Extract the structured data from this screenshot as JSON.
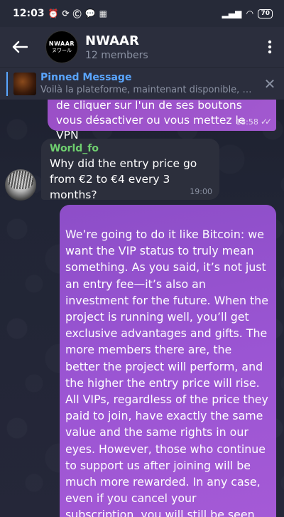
{
  "status_bar": {
    "time": "12:03",
    "icons": [
      "alarm-icon",
      "sync-icon",
      "c-icon",
      "chat-icon",
      "grid-icon"
    ],
    "battery": "70"
  },
  "header": {
    "group_name": "NWAAR",
    "member_count": "12 members",
    "avatar_text_top": "NWAAR",
    "avatar_text_bottom": "ヌワール"
  },
  "pinned": {
    "title": "Pinned Message",
    "preview": "Voilà la plateforme, maintenant disponible, e…"
  },
  "messages": [
    {
      "direction": "outgoing",
      "text": "de cliquer sur l'un de ses boutons vous désactiver ou vous mettez le VPN",
      "time": "18:58",
      "status": "read"
    },
    {
      "direction": "incoming",
      "sender": "World_fo",
      "text": "Why did the entry price go from €2 to €4 every 3 months?",
      "time": "19:00"
    },
    {
      "direction": "outgoing",
      "text": "We’re going to do it like Bitcoin: we want the VIP status to truly mean something. As you said, it’s not just an entry fee—it’s also an investment for the future. When the project is running well, you’ll get exclusive advantages and gifts. The more members there are, the better the project will perform, and the higher the entry price will rise. All VIPs, regardless of the price they paid to join, have exactly the same value and the same rights in our eyes. However, those who continue to support us after joining will be much more rewarded. In any case, even if you cancel your subscription, you will still be seen as a VIP and keep your access."
    }
  ],
  "colors": {
    "outgoing_bubble": "#9b55d3",
    "incoming_bubble": "#2c2f3c",
    "sender_name": "#6fcf6f",
    "pinned_title": "#5aa6ff"
  }
}
